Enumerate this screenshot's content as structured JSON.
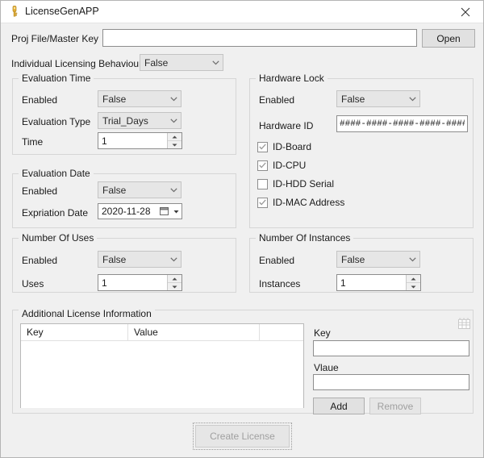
{
  "window": {
    "title": "LicenseGenAPP",
    "icon": "key-icon",
    "close_label": "close-icon"
  },
  "top": {
    "proj_file_label": "Proj File/Master Key",
    "proj_file_value": "",
    "proj_file_placeholder": "",
    "open_button": "Open",
    "individual_licensing_label": "Individual Licensing Behaviour",
    "individual_licensing_value": "False"
  },
  "evaluation_time": {
    "title": "Evaluation Time",
    "enabled_label": "Enabled",
    "enabled_value": "False",
    "type_label": "Evaluation Type",
    "type_value": "Trial_Days",
    "time_label": "Time",
    "time_value": "1"
  },
  "evaluation_date": {
    "title": "Evaluation Date",
    "enabled_label": "Enabled",
    "enabled_value": "False",
    "expiration_label": "Expriation Date",
    "expiration_value": "2020-11-28"
  },
  "number_of_uses": {
    "title": "Number Of Uses",
    "enabled_label": "Enabled",
    "enabled_value": "False",
    "uses_label": "Uses",
    "uses_value": "1"
  },
  "hardware_lock": {
    "title": "Hardware Lock",
    "enabled_label": "Enabled",
    "enabled_value": "False",
    "hardware_id_label": "Hardware ID",
    "hardware_id_value": "####-####-####-####-####",
    "checkboxes": [
      {
        "label": "ID-Board",
        "checked": true
      },
      {
        "label": "ID-CPU",
        "checked": true
      },
      {
        "label": "ID-HDD Serial",
        "checked": false
      },
      {
        "label": "ID-MAC Address",
        "checked": true
      }
    ]
  },
  "number_of_instances": {
    "title": "Number Of Instances",
    "enabled_label": "Enabled",
    "enabled_value": "False",
    "instances_label": "Instances",
    "instances_value": "1"
  },
  "additional_info": {
    "title": "Additional License Information",
    "columns": [
      "Key",
      "Value"
    ],
    "rows": [],
    "key_label": "Key",
    "key_value": "",
    "value_label": "Vlaue",
    "value_value": "",
    "add_button": "Add",
    "remove_button": "Remove",
    "grid_icon": "grid-icon"
  },
  "footer": {
    "create_license_button": "Create License"
  },
  "colors": {
    "window_bg": "#f0f0f0",
    "titlebar_bg": "#ffffff",
    "field_bg": "#ffffff",
    "combo_bg": "#e6e6e6",
    "button_bg": "#e1e1e1",
    "border": "#8d8d8d",
    "group_border": "#d6d6d6",
    "disabled_text": "#a0a0a0",
    "text": "#1a1a1a",
    "icon_gold": "#e8b63b"
  }
}
